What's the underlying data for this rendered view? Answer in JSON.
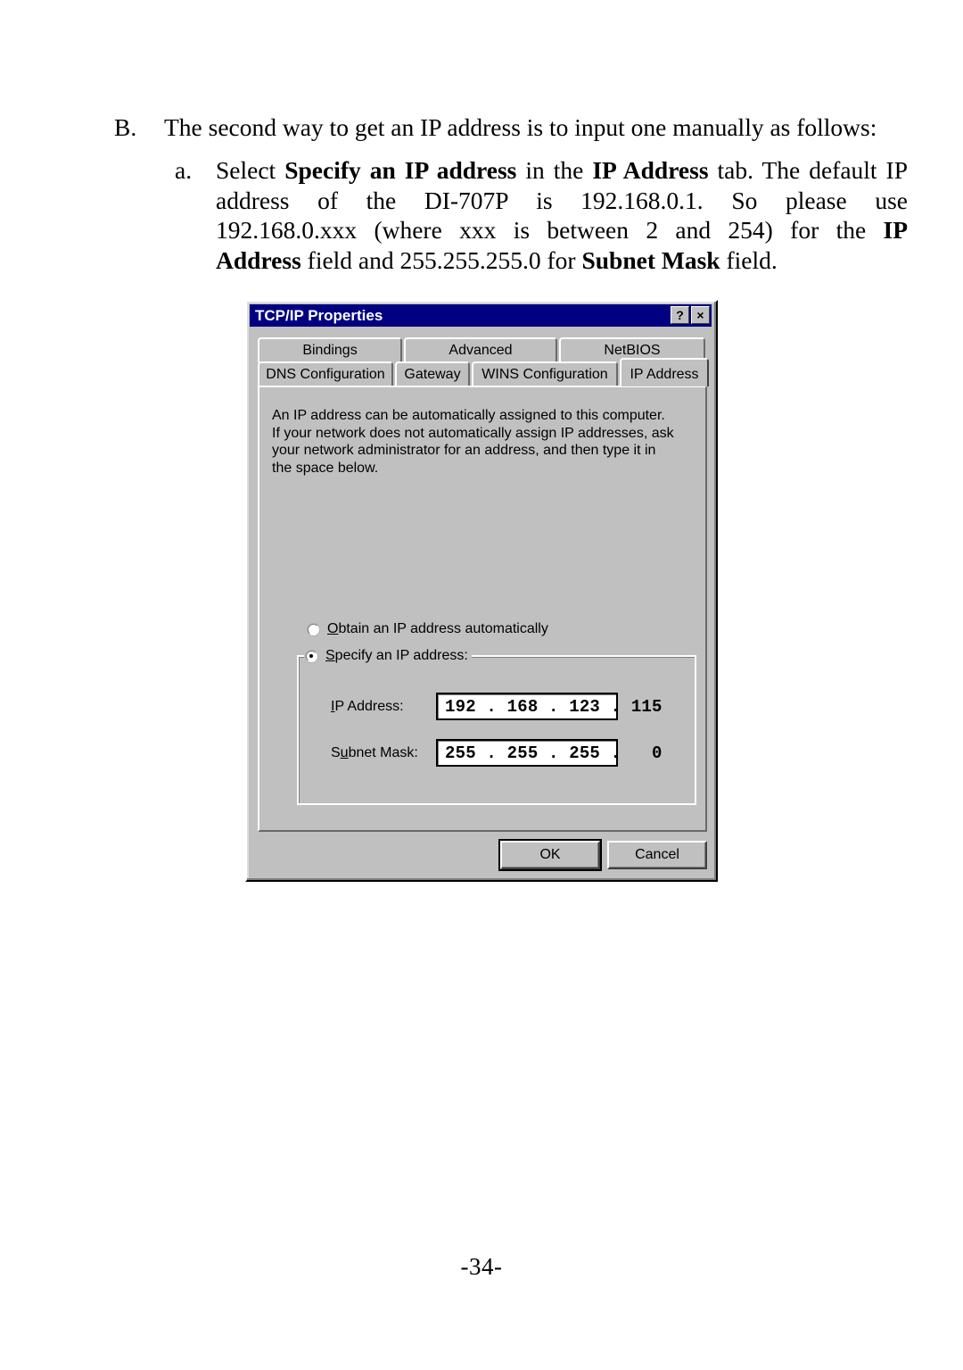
{
  "document": {
    "item_b": {
      "marker": "B.",
      "text": "The second way to get an IP address is to input one manually as follows:"
    },
    "item_a": {
      "marker": "a.",
      "line1_pre": "Select ",
      "line1_bold1": "Specify an IP address",
      "line1_mid": " in the ",
      "line1_bold2": "IP Address",
      "line1_post": " tab. The default IP",
      "line2": "address of the DI-707P is 192.168.0.1. So please use",
      "line3_pre": "192.168.0.xxx (where xxx is between 2 and 254) for the ",
      "line3_bold": "IP",
      "line4_bold1": "Address",
      "line4_mid": " field and 255.255.255.0 for ",
      "line4_bold2": "Subnet Mask",
      "line4_post": " field."
    },
    "page_number": "-34-"
  },
  "dialog": {
    "title": "TCP/IP Properties",
    "titlebar_buttons": [
      {
        "name": "help-button",
        "glyph": "?"
      },
      {
        "name": "close-button",
        "glyph": "×"
      }
    ],
    "tabs_row1": [
      {
        "label": "Bindings",
        "active": false
      },
      {
        "label": "Advanced",
        "active": false
      },
      {
        "label": "NetBIOS",
        "active": false
      }
    ],
    "tabs_row2": [
      {
        "label": "DNS Configuration",
        "active": false
      },
      {
        "label": "Gateway",
        "active": false
      },
      {
        "label": "WINS Configuration",
        "active": false
      },
      {
        "label": "IP Address",
        "active": true
      }
    ],
    "description": [
      "An IP address can be automatically assigned to this computer.",
      "If your network does not automatically assign IP addresses, ask",
      "your network administrator for an address, and then type it in",
      "the space below."
    ],
    "radio_obtain": {
      "label_mnemonic": "O",
      "label_rest": "btain an IP address automatically",
      "checked": false
    },
    "radio_specify": {
      "label_mnemonic": "S",
      "label_rest": "pecify an IP address:",
      "checked": true
    },
    "fields": [
      {
        "label_pre": "",
        "label_mnemonic": "I",
        "label_rest": "P Address:",
        "value": "192 . 168 . 123 . 115",
        "caret": false
      },
      {
        "label_pre": "S",
        "label_mnemonic": "u",
        "label_rest": "bnet Mask:",
        "value": "255 . 255 . 255 .   0",
        "caret": true
      }
    ],
    "buttons": {
      "ok": "OK",
      "cancel": "Cancel"
    },
    "colors": {
      "titlebar": "#000080",
      "face": "#c0c0c0",
      "field_bg": "#ffffff",
      "text": "#000000"
    }
  }
}
